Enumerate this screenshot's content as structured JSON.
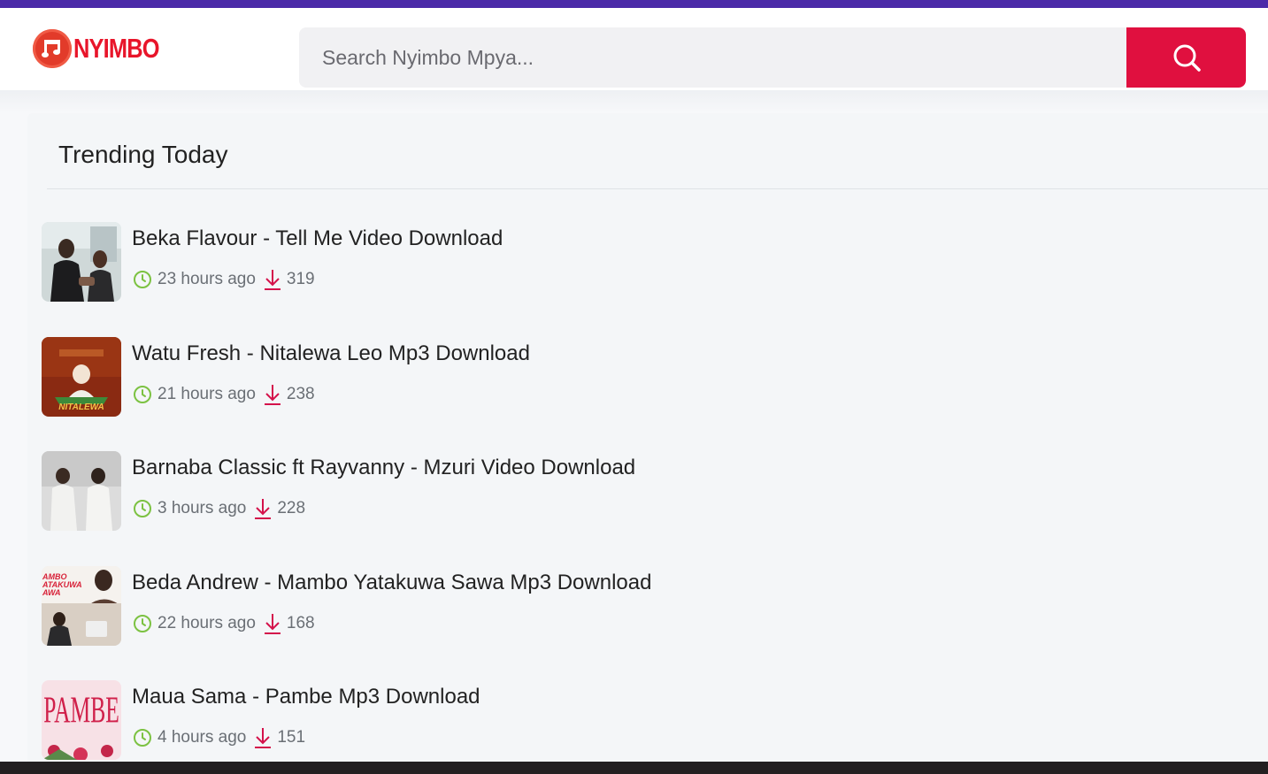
{
  "header": {
    "logo_text": "NYIMBO",
    "search_placeholder": "Search Nyimbo Mpya...",
    "search_button_icon": "search-icon"
  },
  "colors": {
    "topbar": "#4b2aa8",
    "accent": "#e0103f",
    "clock_icon": "#7cc242",
    "download_icon": "#d4124b"
  },
  "trending": {
    "title": "Trending Today",
    "items": [
      {
        "title": "Beka Flavour - Tell Me Video Download",
        "time": "23 hours ago",
        "downloads": "319"
      },
      {
        "title": "Watu Fresh - Nitalewa Leo Mp3 Download",
        "time": "21 hours ago",
        "downloads": "238"
      },
      {
        "title": "Barnaba Classic ft Rayvanny - Mzuri Video Download",
        "time": "3 hours ago",
        "downloads": "228"
      },
      {
        "title": "Beda Andrew - Mambo Yatakuwa Sawa Mp3 Download",
        "time": "22 hours ago",
        "downloads": "168"
      },
      {
        "title": "Maua Sama - Pambe Mp3 Download",
        "time": "4 hours ago",
        "downloads": "151"
      }
    ]
  },
  "thumb_text": {
    "item2": "NITALEWA",
    "item4": "AMBO\nATAKUWA\nAWA",
    "item5": "PAMBE"
  }
}
